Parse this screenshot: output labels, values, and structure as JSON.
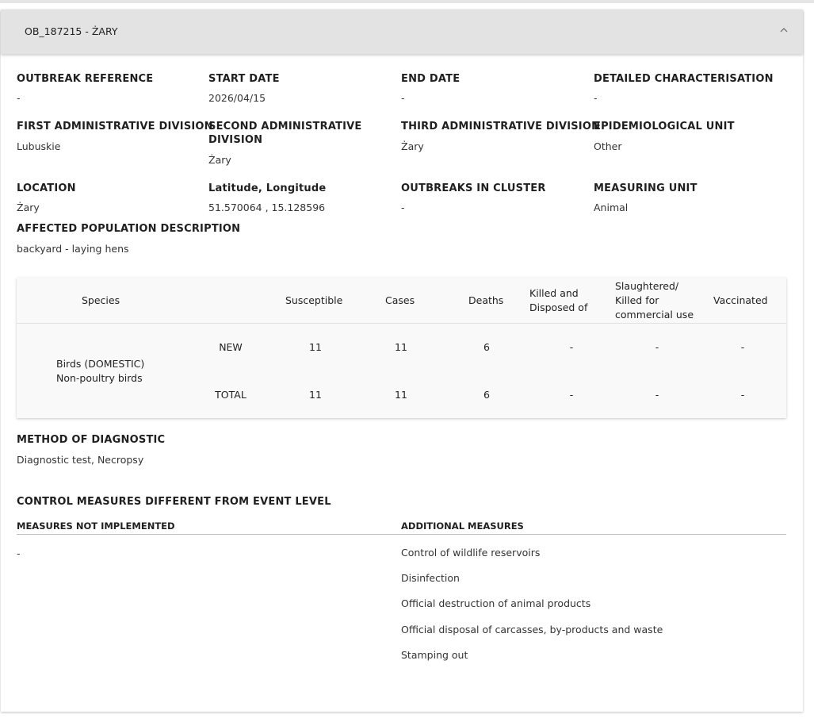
{
  "header": {
    "title": "OB_187215 - ŻARY"
  },
  "fields": {
    "outbreak_reference": {
      "label": "OUTBREAK REFERENCE",
      "value": "-"
    },
    "start_date": {
      "label": "START DATE",
      "value": "2026/04/15"
    },
    "end_date": {
      "label": "END DATE",
      "value": "-"
    },
    "detailed_char": {
      "label": "DETAILED CHARACTERISATION",
      "value": "-"
    },
    "first_admin": {
      "label": "FIRST ADMINISTRATIVE DIVISION",
      "value": "Lubuskie"
    },
    "second_admin": {
      "label": "SECOND ADMINISTRATIVE DIVISION",
      "value": "Żary"
    },
    "third_admin": {
      "label": "THIRD ADMINISTRATIVE DIVISION",
      "value": "Żary"
    },
    "epi_unit": {
      "label": "EPIDEMIOLOGICAL UNIT",
      "value": "Other"
    },
    "location": {
      "label": "LOCATION",
      "value": "Żary"
    },
    "latlon": {
      "label": "Latitude, Longitude",
      "value": "51.570064 , 15.128596"
    },
    "outbreaks_cluster": {
      "label": "OUTBREAKS IN CLUSTER",
      "value": "-"
    },
    "measuring_unit": {
      "label": "MEASURING UNIT",
      "value": "Animal"
    },
    "affected_pop": {
      "label": "AFFECTED POPULATION DESCRIPTION",
      "value": "backyard - laying hens"
    }
  },
  "table": {
    "headers": {
      "species": "Species",
      "susceptible": "Susceptible",
      "cases": "Cases",
      "deaths": "Deaths",
      "killed_line1": "Killed and",
      "killed_line2": "Disposed of",
      "slaughtered_line1": "Slaughtered/",
      "slaughtered_line2": "Killed for",
      "slaughtered_line3": "commercial use",
      "vaccinated": "Vaccinated"
    },
    "species_line1": "Birds (DOMESTIC)",
    "species_line2": "Non-poultry birds",
    "rows": [
      {
        "type": "NEW",
        "susceptible": "11",
        "cases": "11",
        "deaths": "6",
        "killed": "-",
        "slaughtered": "-",
        "vaccinated": "-"
      },
      {
        "type": "TOTAL",
        "susceptible": "11",
        "cases": "11",
        "deaths": "6",
        "killed": "-",
        "slaughtered": "-",
        "vaccinated": "-"
      }
    ]
  },
  "diagnostic": {
    "label": "METHOD OF DIAGNOSTIC",
    "value": "Diagnostic test, Necropsy"
  },
  "control": {
    "title": "CONTROL MEASURES DIFFERENT FROM EVENT LEVEL",
    "not_implemented_label": "MEASURES NOT IMPLEMENTED",
    "not_implemented_value": "-",
    "additional_label": "ADDITIONAL MEASURES",
    "additional": [
      "Control of wildlife reservoirs",
      "Disinfection",
      "Official destruction of animal products",
      "Official disposal of carcasses, by-products and waste",
      "Stamping out"
    ]
  }
}
